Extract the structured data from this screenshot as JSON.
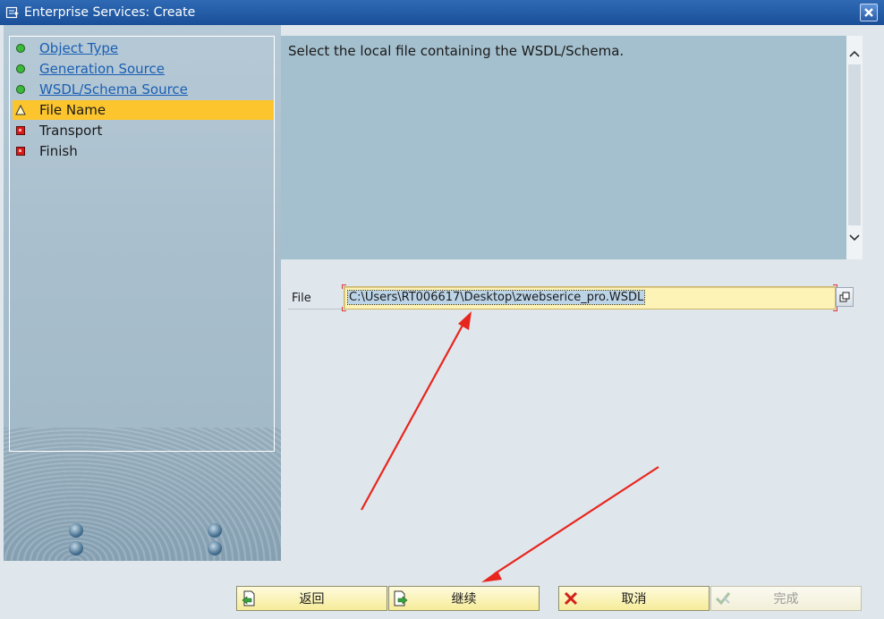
{
  "window": {
    "title": "Enterprise Services: Create",
    "title_icon": "wizard-create-icon",
    "close_icon": "close-icon"
  },
  "steps": [
    {
      "label": "Object Type",
      "status": "done",
      "icon": "green-dot-icon"
    },
    {
      "label": "Generation Source",
      "status": "done",
      "icon": "green-dot-icon"
    },
    {
      "label": "WSDL/Schema Source",
      "status": "done",
      "icon": "green-dot-icon"
    },
    {
      "label": "File Name",
      "status": "current",
      "icon": "warning-triangle-icon"
    },
    {
      "label": "Transport",
      "status": "pending",
      "icon": "red-square-icon"
    },
    {
      "label": "Finish",
      "status": "pending",
      "icon": "red-square-icon"
    }
  ],
  "main": {
    "instruction": "Select the local file containing the WSDL/Schema.",
    "file_label": "File",
    "file_value": "C:\\Users\\RT006617\\Desktop\\zwebserice_pro.WSDL"
  },
  "buttons": {
    "back": "返回",
    "continue": "继续",
    "cancel": "取消",
    "finish": "完成"
  },
  "colors": {
    "titlebar": "#1a4f98",
    "active_step": "#fcc52d",
    "input_bg": "#fdf3b6",
    "annotation_arrow": "#e8261e"
  }
}
